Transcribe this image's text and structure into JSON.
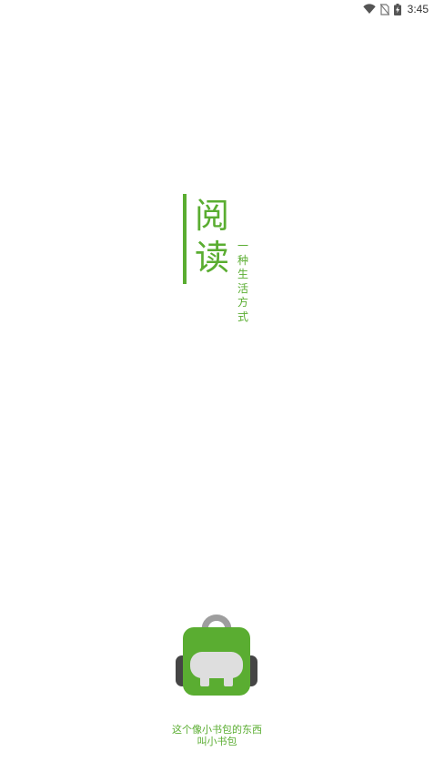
{
  "status_bar": {
    "time": "3:45",
    "icons": [
      "wifi-icon",
      "no-sim-icon",
      "battery-charging-icon"
    ]
  },
  "title": {
    "text": "阅读"
  },
  "slogan": {
    "text": "一种生活方式"
  },
  "logo": {
    "icon": "backpack-icon"
  },
  "caption": {
    "line1": "这个像小书包的东西",
    "line2": "叫小书包"
  },
  "colors": {
    "accent": "#5aad31",
    "background": "#ffffff",
    "status_text": "#333333"
  }
}
